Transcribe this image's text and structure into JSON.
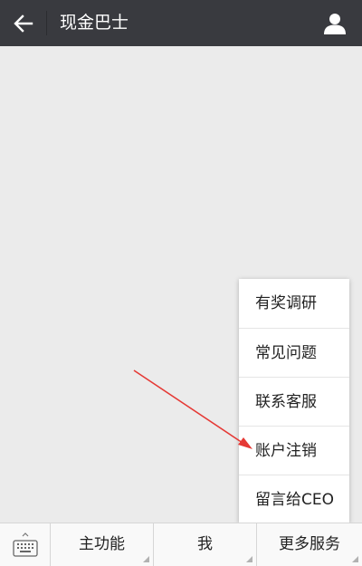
{
  "header": {
    "title": "现金巴士",
    "back_icon": "arrow-left-icon",
    "profile_icon": "user-icon"
  },
  "menu": {
    "items": [
      {
        "label": "有奖调研"
      },
      {
        "label": "常见问题"
      },
      {
        "label": "联系客服"
      },
      {
        "label": "账户注销"
      },
      {
        "label": "留言给CEO"
      }
    ]
  },
  "bottom": {
    "keyboard_icon": "keyboard-icon",
    "tabs": [
      {
        "label": "主功能"
      },
      {
        "label": "我"
      },
      {
        "label": "更多服务"
      }
    ]
  },
  "colors": {
    "header_bg": "#393a3f",
    "page_bg": "#ebebeb",
    "annotation_arrow": "#e53935"
  }
}
